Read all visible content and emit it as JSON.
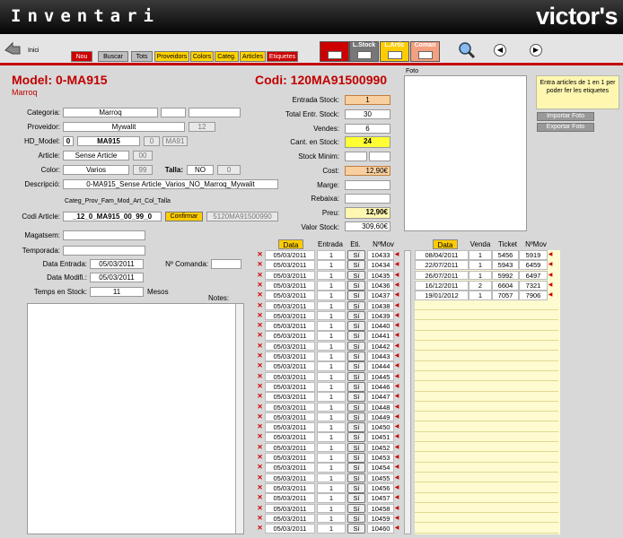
{
  "app": {
    "title": "Inventari",
    "brand": "victor's"
  },
  "toolbar": {
    "home_label": "Inici",
    "tabs": [
      "Nou",
      "Buscar",
      "Tots",
      "Proveidors",
      "Colors",
      "Categ.",
      "Articles",
      "Etiquetes"
    ],
    "big_tabs": [
      "",
      "L.Stock",
      "L.Artic",
      "Coman"
    ]
  },
  "model": {
    "title": "Model: 0-MA915",
    "subtitle": "Marroq",
    "codi_title": "Codi: 120MA91500990"
  },
  "form": {
    "categoria_label": "Categoria:",
    "categoria": "Marroq",
    "proveidor_label": "Proveidor:",
    "proveidor": "Mywalit",
    "proveidor_num": "12",
    "hdmodel_label": "HD_Model:",
    "hdmodel_a": "0",
    "hdmodel_b": "MA915",
    "hdmodel_c": "0",
    "hdmodel_d": "MA91",
    "article_label": "Article:",
    "article": "Sense Article",
    "article_num": "00",
    "color_label": "Color:",
    "color": "Varios",
    "color_num": "99",
    "talla_label": "Talla:",
    "talla": "NO",
    "talla_num": "0",
    "descripcio_label": "Descripció:",
    "descripcio": "0-MA915_Sense Article_Varios_NO_Marroq_Mywalit",
    "codi_hint": "Categ_Prov_Fam_Mod_Art_Col_Talla",
    "codi_label": "Codi Article:",
    "codi": "_12_0_MA915_00_99_0",
    "confirmar": "Confirmar",
    "codi_grey": "5120MA91500990",
    "magatsem_label": "Magatsem:",
    "temporada_label": "Temporada:",
    "data_entrada_label": "Data Entrada:",
    "data_entrada": "05/03/2011",
    "data_modifi_label": "Data Modifi.:",
    "data_modifi": "05/03/2011",
    "comanda_label": "Nº Comanda:",
    "temps_label": "Temps en Stock:",
    "temps": "11",
    "temps_unit": "Mesos",
    "notes_label": "Notes:"
  },
  "stock": {
    "entrada_label": "Entrada Stock:",
    "entrada": "1",
    "total_label": "Total Entr. Stock:",
    "total": "30",
    "vendes_label": "Vendes:",
    "vendes": "6",
    "cant_label": "Cant. en Stock:",
    "cant": "24",
    "minim_label": "Stock Minim:",
    "cost_label": "Cost:",
    "cost": "12,90€",
    "marge_label": "Marge:",
    "rebaixa_label": "Rebaixa:",
    "preu_label": "Preu:",
    "preu": "12,90€",
    "valor_label": "Valor Stock:",
    "valor": "309,60€"
  },
  "foto": {
    "label": "Foto",
    "note": "Entra articles de 1 en 1 per poder fer les etiquetes",
    "importar": "Importar Foto",
    "exportar": "Exportar Foto"
  },
  "entries": {
    "headers": {
      "data": "Data",
      "entrada": "Entrada",
      "eti": "Eti.",
      "nmov": "NºMov"
    },
    "date": "05/03/2011",
    "qty": "1",
    "si": "Sí",
    "movs": [
      "10433",
      "10434",
      "10435",
      "10436",
      "10437",
      "10438",
      "10439",
      "10440",
      "10441",
      "10442",
      "10443",
      "10444",
      "10445",
      "10446",
      "10447",
      "10448",
      "10449",
      "10450",
      "10451",
      "10452",
      "10453",
      "10454",
      "10455",
      "10456",
      "10457",
      "10458",
      "10459",
      "10460"
    ]
  },
  "sales": {
    "headers": {
      "data": "Data",
      "venda": "Venda",
      "ticket": "Ticket",
      "nmov": "NºMov"
    },
    "rows": [
      {
        "date": "08/04/2011",
        "venda": "1",
        "ticket": "5456",
        "mov": "5919"
      },
      {
        "date": "22/07/2011",
        "venda": "1",
        "ticket": "5943",
        "mov": "6459"
      },
      {
        "date": "26/07/2011",
        "venda": "1",
        "ticket": "5992",
        "mov": "6497"
      },
      {
        "date": "16/12/2011",
        "venda": "2",
        "ticket": "6604",
        "mov": "7321"
      },
      {
        "date": "19/01/2012",
        "venda": "1",
        "ticket": "7057",
        "mov": "7906"
      }
    ]
  },
  "colors": {
    "accent": "#cc0000",
    "highlight": "#ffff33",
    "orange": "#f8d0a0"
  }
}
